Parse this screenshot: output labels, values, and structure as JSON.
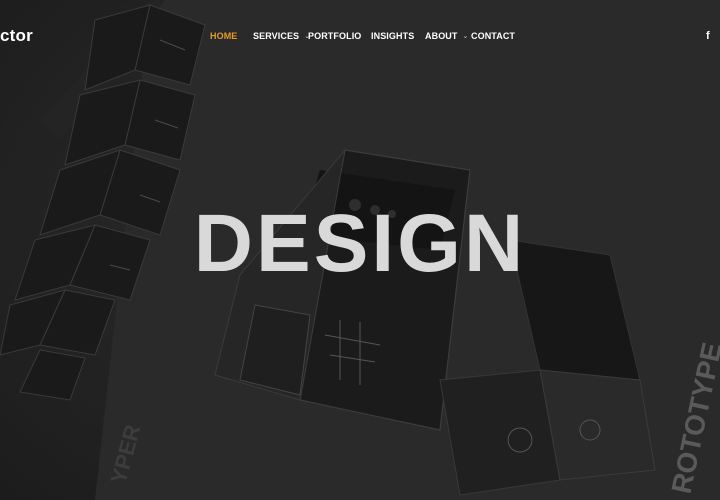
{
  "brand": {
    "logo_text": "ctor"
  },
  "nav": {
    "items": [
      {
        "label": "HOME",
        "active": true,
        "has_dropdown": false
      },
      {
        "label": "SERVICES",
        "active": false,
        "has_dropdown": true
      },
      {
        "label": "PORTFOLIO",
        "active": false,
        "has_dropdown": false
      },
      {
        "label": "INSIGHTS",
        "active": false,
        "has_dropdown": false
      },
      {
        "label": "ABOUT",
        "active": false,
        "has_dropdown": true
      },
      {
        "label": "CONTACT",
        "active": false,
        "has_dropdown": false
      }
    ],
    "dropdown_icon": "chevron-down-icon",
    "active_color": "#e59a2a"
  },
  "social": {
    "facebook_glyph": "f",
    "icon": "facebook-icon"
  },
  "hero": {
    "headline": "DESIGN",
    "background_image_text": {
      "left": "YPER",
      "right": "ROTOTYPE"
    }
  }
}
